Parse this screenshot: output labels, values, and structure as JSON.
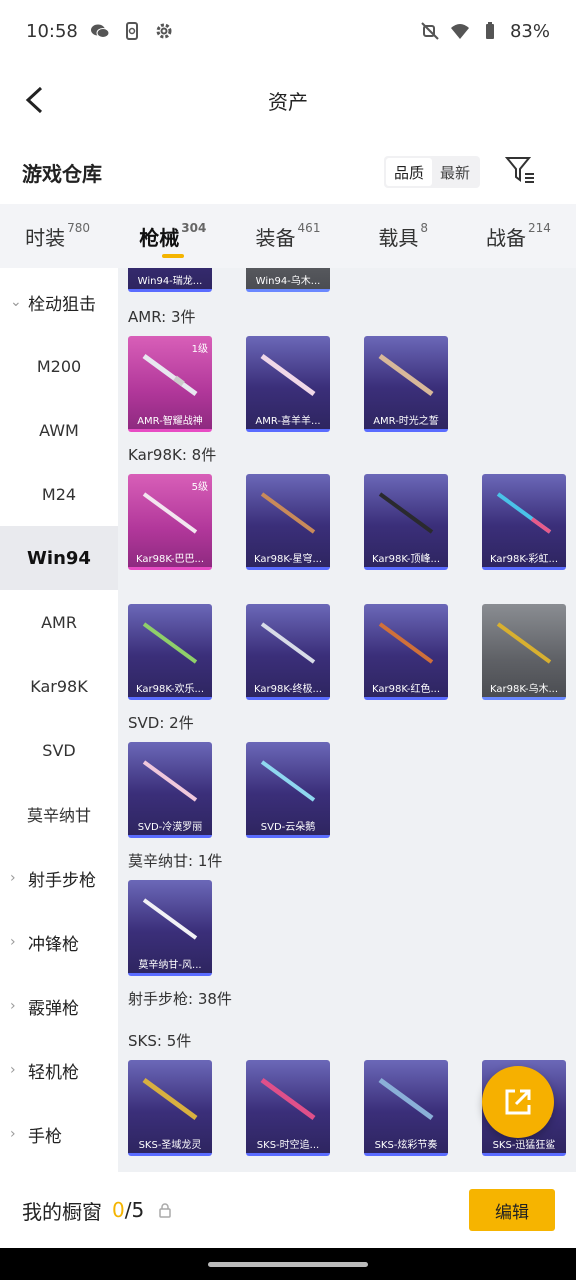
{
  "status": {
    "time": "10:58",
    "battery": "83%"
  },
  "title": "资产",
  "section": {
    "title": "游戏仓库",
    "sort_quality": "品质",
    "sort_latest": "最新"
  },
  "tabs": [
    {
      "label": "时装",
      "count": "780"
    },
    {
      "label": "枪械",
      "count": "304"
    },
    {
      "label": "装备",
      "count": "461"
    },
    {
      "label": "载具",
      "count": "8"
    },
    {
      "label": "战备",
      "count": "214"
    }
  ],
  "sidenav": {
    "group_bolt": "栓动狙击",
    "m200": "M200",
    "awm": "AWM",
    "m24": "M24",
    "win94": "Win94",
    "amr": "AMR",
    "kar98k": "Kar98K",
    "svd": "SVD",
    "mosin": "莫辛纳甘",
    "group_marksman": "射手步枪",
    "group_smg": "冲锋枪",
    "group_shotgun": "霰弹枪",
    "group_lmg": "轻机枪",
    "group_pistol": "手枪"
  },
  "content": {
    "win94_cards": [
      "Win94-瑞龙...",
      "Win94-乌木..."
    ],
    "amr_label": "AMR: 3件",
    "amr_cards": [
      {
        "name": "AMR-智耀战神",
        "level": "1级"
      },
      {
        "name": "AMR-喜羊羊..."
      },
      {
        "name": "AMR-时光之誓"
      }
    ],
    "kar_label": "Kar98K: 8件",
    "kar_cards": [
      {
        "name": "Kar98K-巴巴...",
        "level": "5级"
      },
      {
        "name": "Kar98K-星穹..."
      },
      {
        "name": "Kar98K-顶峰..."
      },
      {
        "name": "Kar98K-彩虹..."
      },
      {
        "name": "Kar98K-欢乐..."
      },
      {
        "name": "Kar98K-终极..."
      },
      {
        "name": "Kar98K-红色..."
      },
      {
        "name": "Kar98K-乌木..."
      }
    ],
    "svd_label": "SVD: 2件",
    "svd_cards": [
      "SVD-冷漠罗丽",
      "SVD-云朵鹅"
    ],
    "mosin_label": "莫辛纳甘: 1件",
    "mosin_cards": [
      "莫辛纳甘-风..."
    ],
    "marksman_label": "射手步枪: 38件",
    "sks_label": "SKS: 5件",
    "sks_cards": [
      "SKS-圣域龙灵",
      "SKS-时空追...",
      "SKS-炫彩节奏",
      "SKS-迅猛狂鲨"
    ]
  },
  "bottom": {
    "showcase_label": "我的橱窗",
    "showcase_current": "0",
    "showcase_total": "/5",
    "edit_label": "编辑"
  },
  "colors": {
    "accent": "#f6b400",
    "purple_card": "#3b2f7a",
    "pink_card": "#b1379a"
  }
}
